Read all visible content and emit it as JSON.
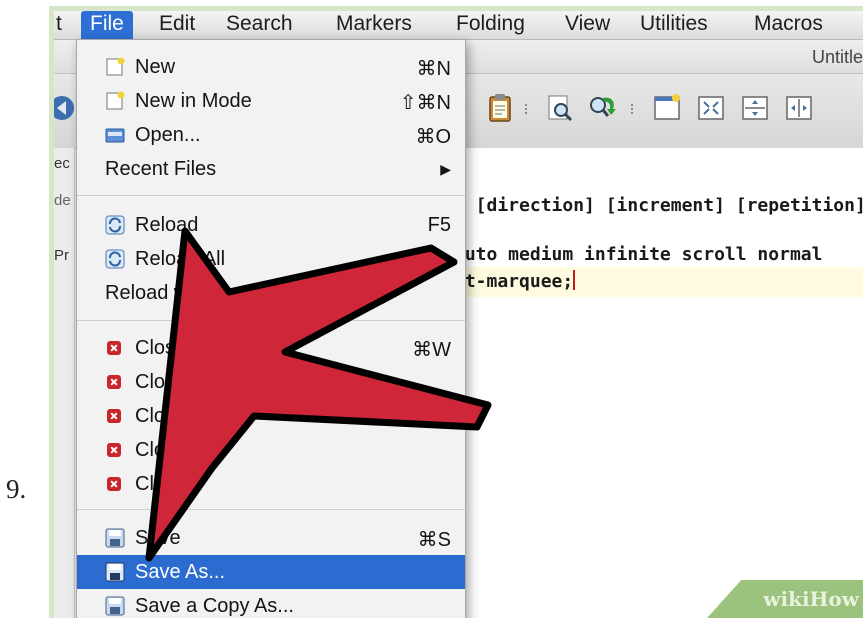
{
  "step_number": "9.",
  "menubar": {
    "items": [
      "t",
      "File",
      "Edit",
      "Search",
      "Markers",
      "Folding",
      "View",
      "Utilities",
      "Macros"
    ]
  },
  "window": {
    "title": "Untitle"
  },
  "side_edge": {
    "line1": "ec",
    "line2": "de",
    "line3": "Pr"
  },
  "editor": {
    "line1": ": [direction] [increment] [repetition]",
    "line2": "auto medium infinite scroll normal",
    "line3": "it-marquee;"
  },
  "file_menu": {
    "new": {
      "label": "New",
      "shortcut": "⌘N"
    },
    "new_in_mode": {
      "label": "New in Mode",
      "shortcut": "⇧⌘N"
    },
    "open": {
      "label": "Open...",
      "shortcut": "⌘O"
    },
    "recent_files": {
      "label": "Recent Files",
      "shortcut": "▶"
    },
    "reload": {
      "label": "Reload",
      "shortcut": "F5"
    },
    "reload_all": {
      "label": "Reload All",
      "shortcut": ""
    },
    "reload_with_encoding": {
      "label": "Reload with Er",
      "label_tail": "ng",
      "shortcut": ""
    },
    "close": {
      "label": "Close",
      "shortcut": "⌘W"
    },
    "close_others": {
      "label": "Close Ot",
      "shortcut": ""
    },
    "close_all": {
      "label": "Close A",
      "shortcut": ""
    },
    "close_4": {
      "label": "Close (",
      "shortcut": ""
    },
    "close_5": {
      "label": "Close",
      "shortcut": ""
    },
    "save": {
      "label": "Save",
      "shortcut": "⌘S"
    },
    "save_as": {
      "label": "Save As...",
      "shortcut": ""
    },
    "save_copy_as": {
      "label": "Save a Copy As...",
      "shortcut": ""
    }
  },
  "watermark": "wikiHow",
  "colors": {
    "selection": "#2c6bd0",
    "arrow": "#d0263a",
    "watermark_bg": "#9bc37e"
  }
}
